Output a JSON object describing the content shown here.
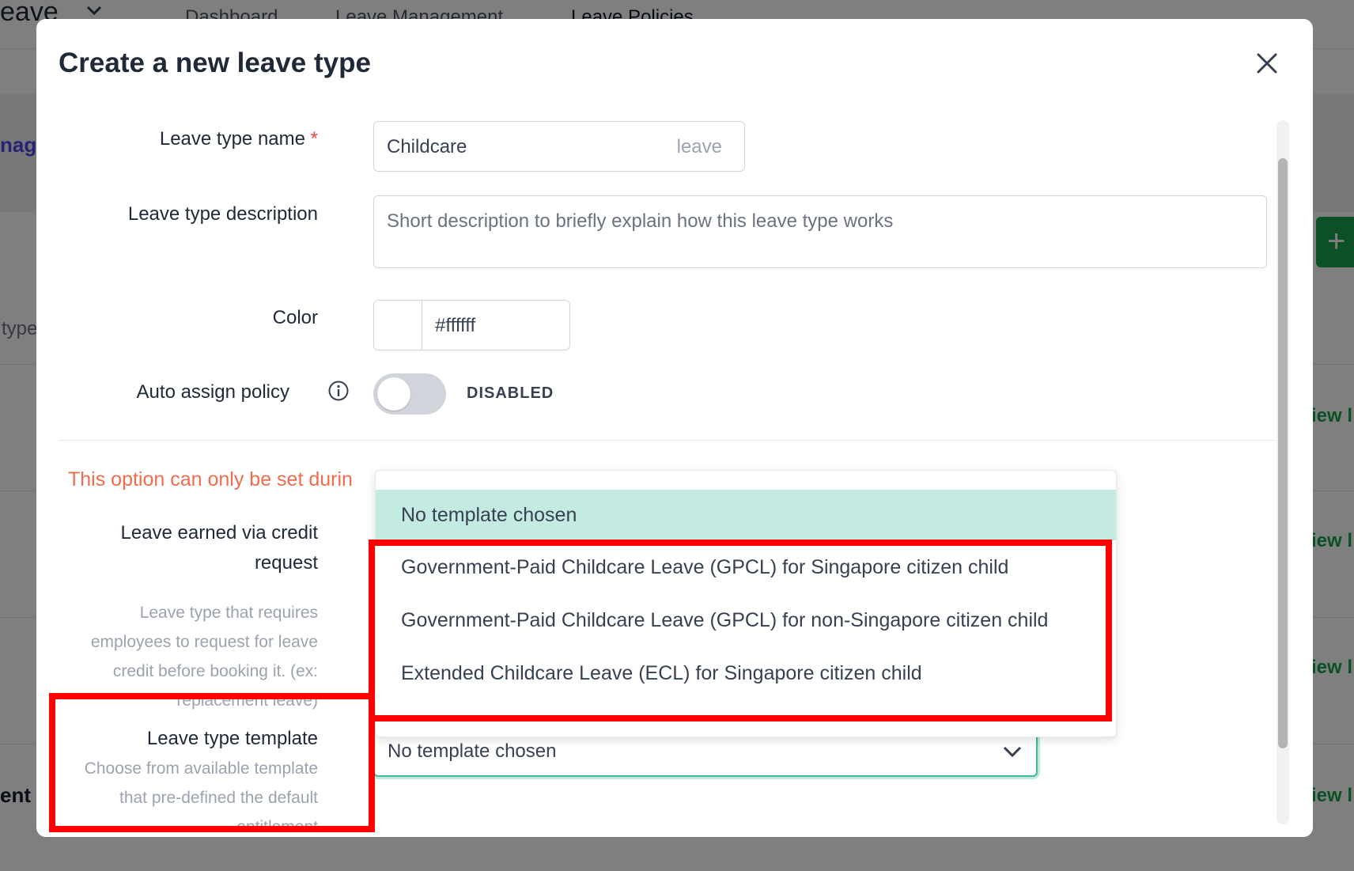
{
  "background": {
    "app_title": "eave",
    "nav": [
      "Dashboard",
      "Leave Management",
      "Leave Policies"
    ],
    "side_link": "nage",
    "side_text": "type",
    "view_link": "iew l",
    "row_text": "ent"
  },
  "modal": {
    "title": "Create a new leave type",
    "leave_type_name": {
      "label": "Leave type name",
      "required_mark": "*",
      "value": "Childcare",
      "suffix": "leave"
    },
    "leave_type_description": {
      "label": "Leave type description",
      "placeholder": "Short description to briefly explain how this leave type works"
    },
    "color": {
      "label": "Color",
      "value": "#ffffff"
    },
    "auto_assign": {
      "label": "Auto assign policy",
      "state": "DISABLED"
    },
    "warning": "This option can only be set durin",
    "credit_request": {
      "label_line1": "Leave earned via credit",
      "label_line2": "request",
      "hint": [
        "Leave type that requires",
        "employees to request for leave",
        "credit before booking it. (ex:",
        "replacement leave)"
      ]
    },
    "template": {
      "label": "Leave type template",
      "hint": [
        "Choose from available template",
        "that pre-defined the default",
        "entitlement"
      ],
      "selected": "No template chosen",
      "options": [
        "No template chosen",
        "Government-Paid Childcare Leave (GPCL) for Singapore citizen child",
        "Government-Paid Childcare Leave (GPCL) for non-Singapore citizen child",
        "Extended Childcare Leave (ECL) for Singapore citizen child"
      ]
    }
  },
  "colors": {
    "accent": "#3fb89b",
    "selected_option_bg": "#c4ebe1",
    "warning": "#f26b4d",
    "highlight": "#ff0000"
  }
}
